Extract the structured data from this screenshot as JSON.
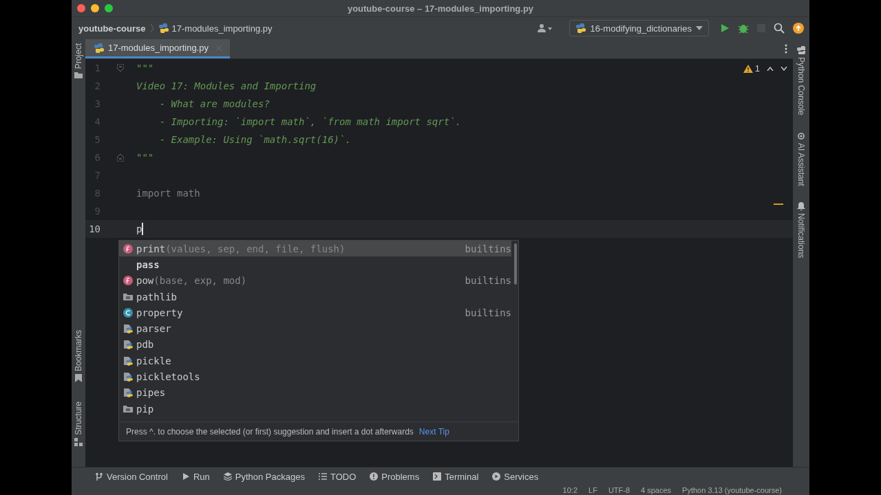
{
  "window": {
    "title": "youtube-course – 17-modules_importing.py"
  },
  "navbar": {
    "breadcrumbs": [
      "youtube-course",
      "17-modules_importing.py"
    ],
    "run_config": "16-modifying_dictionaries"
  },
  "left_stripe": {
    "top": [
      "Project"
    ],
    "bottom": [
      "Bookmarks",
      "Structure"
    ]
  },
  "right_stripe": [
    "Python Console",
    "AI Assistant",
    "Notifications"
  ],
  "tabs": [
    {
      "label": "17-modules_importing.py",
      "selected": true
    }
  ],
  "inspections": {
    "warnings": "1"
  },
  "editor": {
    "lines": [
      {
        "number": "1",
        "text": "\"\"\"",
        "kind": "docstring",
        "current": false
      },
      {
        "number": "2",
        "text": "Video 17: Modules and Importing",
        "kind": "docstring",
        "current": false
      },
      {
        "number": "3",
        "text": "    - What are modules?",
        "kind": "docstring",
        "current": false
      },
      {
        "number": "4",
        "text": "    - Importing: `import math`, `from math import sqrt`.",
        "kind": "docstring",
        "current": false
      },
      {
        "number": "5",
        "text": "    - Example: Using `math.sqrt(16)`.",
        "kind": "docstring",
        "current": false
      },
      {
        "number": "6",
        "text": "\"\"\"",
        "kind": "docstring",
        "current": false
      },
      {
        "number": "7",
        "kind": "code",
        "current": false
      },
      {
        "number": "8",
        "text": "import math",
        "kind": "unused",
        "current": false
      },
      {
        "number": "9",
        "kind": "code",
        "current": false
      },
      {
        "number": "10",
        "text": "p",
        "kind": "code",
        "current": true
      }
    ]
  },
  "completion": {
    "items": [
      {
        "name": "print",
        "params": "(values, sep, end, file, flush)",
        "source": "builtins",
        "kind": "function",
        "selected": true
      },
      {
        "name": "pass",
        "kind": "keyword",
        "selected": false
      },
      {
        "name": "pow",
        "params": "(base, exp, mod)",
        "source": "builtins",
        "kind": "function",
        "selected": false
      },
      {
        "name": "pathlib",
        "kind": "package",
        "selected": false
      },
      {
        "name": "property",
        "source": "builtins",
        "kind": "class",
        "selected": false
      },
      {
        "name": "parser",
        "kind": "module",
        "selected": false
      },
      {
        "name": "pdb",
        "kind": "module",
        "selected": false
      },
      {
        "name": "pickle",
        "kind": "module",
        "selected": false
      },
      {
        "name": "pickletools",
        "kind": "module",
        "selected": false
      },
      {
        "name": "pipes",
        "kind": "module",
        "selected": false
      },
      {
        "name": "pip",
        "kind": "package",
        "selected": false
      }
    ],
    "hint": "Press ^. to choose the selected (or first) suggestion and insert a dot afterwards",
    "next_tip": "Next Tip"
  },
  "tool_windows": [
    {
      "label": "Version Control",
      "kind": "vcs"
    },
    {
      "label": "Run",
      "kind": "run"
    },
    {
      "label": "Python Packages",
      "kind": "packages"
    },
    {
      "label": "TODO",
      "kind": "todo"
    },
    {
      "label": "Problems",
      "kind": "problems"
    },
    {
      "label": "Terminal",
      "kind": "terminal"
    },
    {
      "label": "Services",
      "kind": "services"
    }
  ],
  "status_bar": [
    "10:2",
    "LF",
    "UTF-8",
    "4 spaces",
    "Python 3.13 (youtube-course)"
  ]
}
